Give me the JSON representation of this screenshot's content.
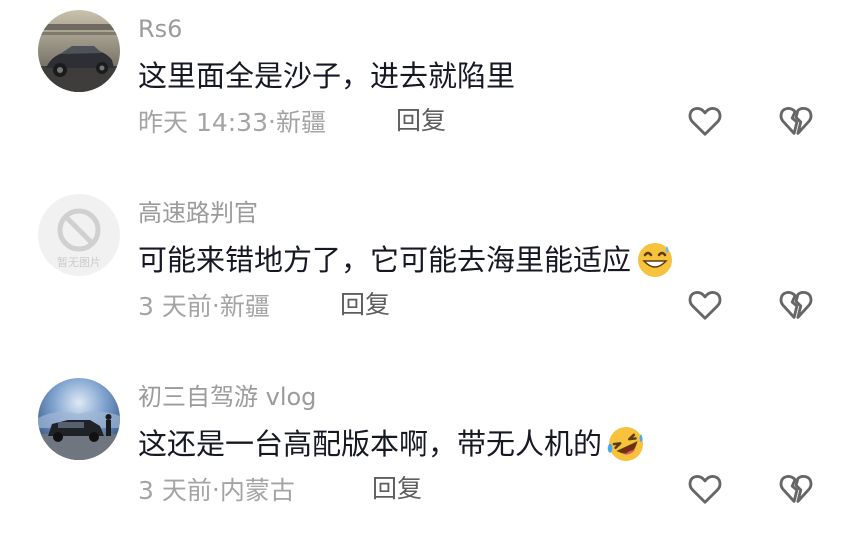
{
  "comments": [
    {
      "username": "Rs6",
      "text": "这里面全是沙子，进去就陷里",
      "time": "昨天 14:33",
      "separator": "·",
      "location": "新疆",
      "reply_label": "回复",
      "emoji": "",
      "avatar": "car-photo"
    },
    {
      "username": "高速路判官",
      "text": "可能来错地方了，它可能去海里能适应",
      "time": "3 天前",
      "separator": "·",
      "location": "新疆",
      "reply_label": "回复",
      "emoji": "grinning-sweat-emoji",
      "avatar": "no-image-placeholder",
      "avatar_watermark": "暂无图片"
    },
    {
      "username": "初三自驾游 vlog",
      "text": "这还是一台高配版本啊，带无人机的",
      "time": "3 天前",
      "separator": "·",
      "location": "内蒙古",
      "reply_label": "回复",
      "emoji": "rolling-laughing-emoji",
      "avatar": "suv-photo"
    }
  ],
  "icons": {
    "like": "heart-outline-icon",
    "dislike": "broken-heart-outline-icon"
  },
  "colors": {
    "username": "#9b9b9b",
    "text": "#161823",
    "meta": "#a4a4a4",
    "reply": "#5e5e5e",
    "icon": "#666666"
  }
}
